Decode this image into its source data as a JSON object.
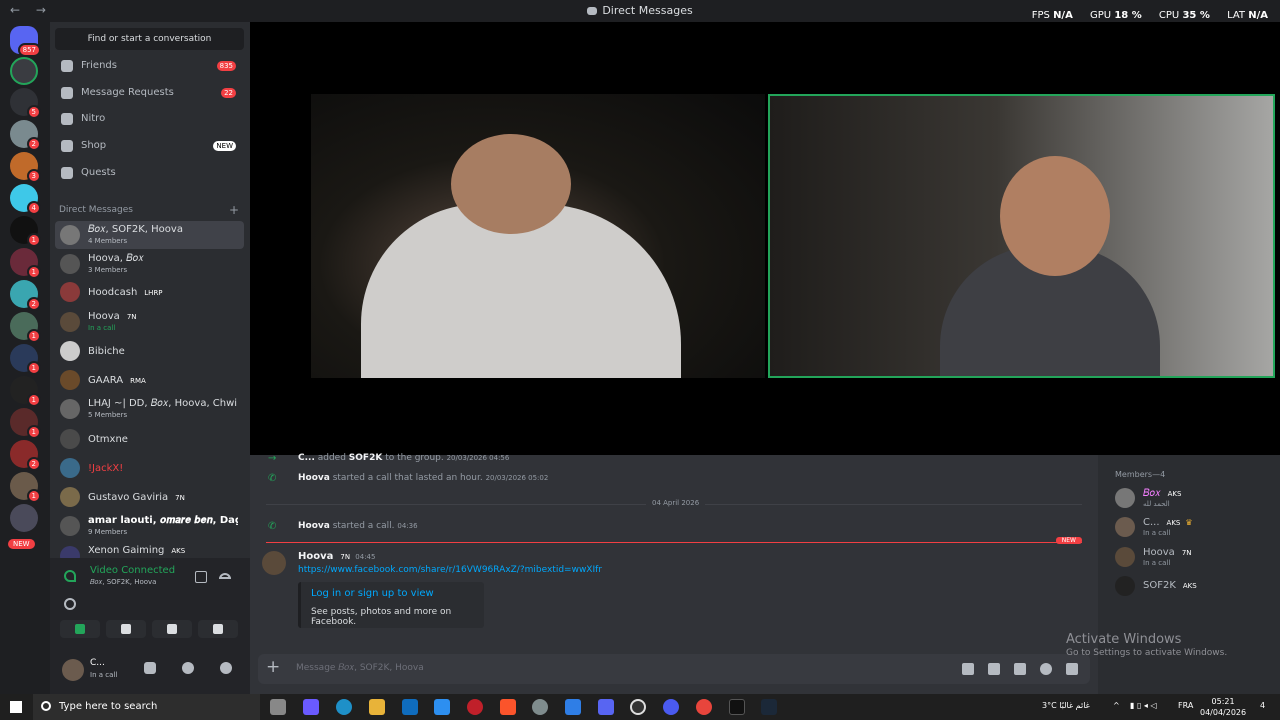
{
  "titlebar": {
    "title": "Direct Messages",
    "nav": "← →",
    "fps_label": "FPS",
    "fps": "N/A",
    "gpu_label": "GPU",
    "gpu": "18 %",
    "cpu_label": "CPU",
    "cpu": "35 %",
    "lat_label": "LAT",
    "lat": "N/A"
  },
  "servers": {
    "home_badge": "857",
    "badges": [
      "5",
      "2",
      "3",
      "4",
      "1",
      "1",
      "2",
      "1",
      "1",
      "1",
      "1",
      "2",
      "1"
    ],
    "new_label": "NEW"
  },
  "sidebar": {
    "search": "Find or start a conversation",
    "nav": [
      {
        "label": "Friends",
        "count": "835"
      },
      {
        "label": "Message Requests",
        "count": "22"
      },
      {
        "label": "Nitro",
        "count": ""
      },
      {
        "label": "Shop",
        "badge": "NEW"
      },
      {
        "label": "Quests",
        "count": ""
      }
    ],
    "dm_header": "Direct Messages",
    "dm_plus": "+",
    "dms": [
      {
        "name": "𝐵𝑜𝑥, SOF2K, Hoova",
        "sub": "4 Members"
      },
      {
        "name": "Hoova, 𝐵𝑜𝑥",
        "sub": "3 Members"
      },
      {
        "name": "Hoodcash",
        "tag": "LHRP"
      },
      {
        "name": "Hoova",
        "tag": "7N",
        "sub": "In a call"
      },
      {
        "name": "Bibiche"
      },
      {
        "name": "GAARA",
        "tag": "RMA"
      },
      {
        "name": "LHAJ ~| DD, 𝐵𝑜𝑥, Hoova, Chwi...",
        "sub": "5 Members"
      },
      {
        "name": "Otmxne"
      },
      {
        "name": "!JackX!"
      },
      {
        "name": "Gustavo Gaviria",
        "tag": "7N"
      },
      {
        "name": "amar laouti, 𝒐𝒎𝒂𝒓𝒆 𝒃𝒆𝒏, DagLa...",
        "sub": "9 Members"
      },
      {
        "name": "Xenon Gaiming",
        "tag": "AKS"
      }
    ],
    "voice": {
      "title": "Video Connected",
      "sub": "𝐵𝑜𝑥, SOF2K, Hoova"
    },
    "user": {
      "name": "C...",
      "status": "In a call"
    }
  },
  "chat": {
    "sys1": {
      "actor": "C...",
      "text": " added ",
      "target": "SOF2K",
      "tail": " to the group.",
      "time": "20/03/2026 04:56"
    },
    "sys2": {
      "actor": "Hoova",
      "text": " started a call that lasted an hour.",
      "time": "20/03/2026 05:02"
    },
    "date_divider": "04 April 2026",
    "sys3": {
      "actor": "Hoova",
      "text": " started a call.",
      "time": "04:36"
    },
    "new_label": "NEW",
    "message": {
      "author": "Hoova",
      "tag": "7N",
      "time": "04:45",
      "link": "https://www.facebook.com/share/r/16VW96RAxZ/?mibextid=wwXIfr"
    },
    "embed": {
      "title": "Log in or sign up to view",
      "desc": "See posts, photos and more on Facebook."
    },
    "composer_placeholder": "Message 𝐵𝑜𝑥, SOF2K, Hoova",
    "composer_plus": "+"
  },
  "members": {
    "header": "Members—4",
    "list": [
      {
        "name": "𝐵𝑜𝑥",
        "tag": "AKS",
        "sub": "الحمد لله"
      },
      {
        "name": "C...",
        "tag": "AKS",
        "sub": "In a call"
      },
      {
        "name": "Hoova",
        "tag": "7N",
        "sub": "In a call"
      },
      {
        "name": "SOF2K",
        "tag": "AKS",
        "sub": ""
      }
    ]
  },
  "watermark": {
    "title": "Activate Windows",
    "sub": "Go to Settings to activate Windows."
  },
  "taskbar": {
    "search": "Type here to search",
    "weather": "3°C غائم غالبًا",
    "lang": "FRA",
    "time": "05:21",
    "date": "04/04/2026",
    "notif": "4"
  }
}
